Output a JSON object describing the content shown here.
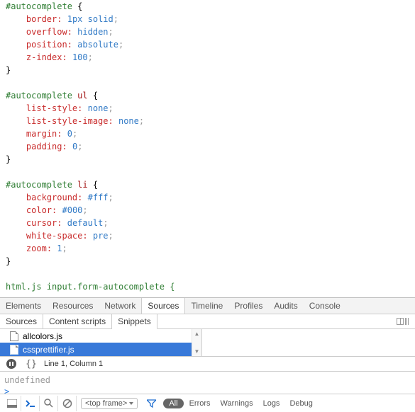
{
  "code": {
    "blocks": [
      {
        "selector_id": "#autocomplete",
        "selector_rest": "",
        "props": [
          {
            "name": "border",
            "value": "1px solid"
          },
          {
            "name": "overflow",
            "value": "hidden"
          },
          {
            "name": "position",
            "value": "absolute"
          },
          {
            "name": "z-index",
            "value": "100"
          }
        ]
      },
      {
        "selector_id": "#autocomplete",
        "selector_rest": " ul",
        "props": [
          {
            "name": "list-style",
            "value": "none"
          },
          {
            "name": "list-style-image",
            "value": "none"
          },
          {
            "name": "margin",
            "value": "0"
          },
          {
            "name": "padding",
            "value": "0"
          }
        ]
      },
      {
        "selector_id": "#autocomplete",
        "selector_rest": " li",
        "props": [
          {
            "name": "background",
            "value": "#fff"
          },
          {
            "name": "color",
            "value": "#000"
          },
          {
            "name": "cursor",
            "value": "default"
          },
          {
            "name": "white-space",
            "value": "pre"
          },
          {
            "name": "zoom",
            "value": "1"
          }
        ]
      }
    ],
    "partial_line": "html.js input.form-autocomplete {"
  },
  "main_tabs": [
    "Elements",
    "Resources",
    "Network",
    "Sources",
    "Timeline",
    "Profiles",
    "Audits",
    "Console"
  ],
  "main_tabs_active": 3,
  "sub_tabs": [
    "Sources",
    "Content scripts",
    "Snippets"
  ],
  "sub_tabs_active": 2,
  "files": [
    {
      "name": "allcolors.js",
      "selected": false
    },
    {
      "name": "cssprettifier.js",
      "selected": true
    }
  ],
  "status": {
    "cursor": "Line 1, Column 1"
  },
  "console": {
    "out": "undefined",
    "prompt": ">"
  },
  "bottom": {
    "frame": "<top frame>",
    "pill_all": "All",
    "links": [
      "Errors",
      "Warnings",
      "Logs",
      "Debug"
    ]
  }
}
